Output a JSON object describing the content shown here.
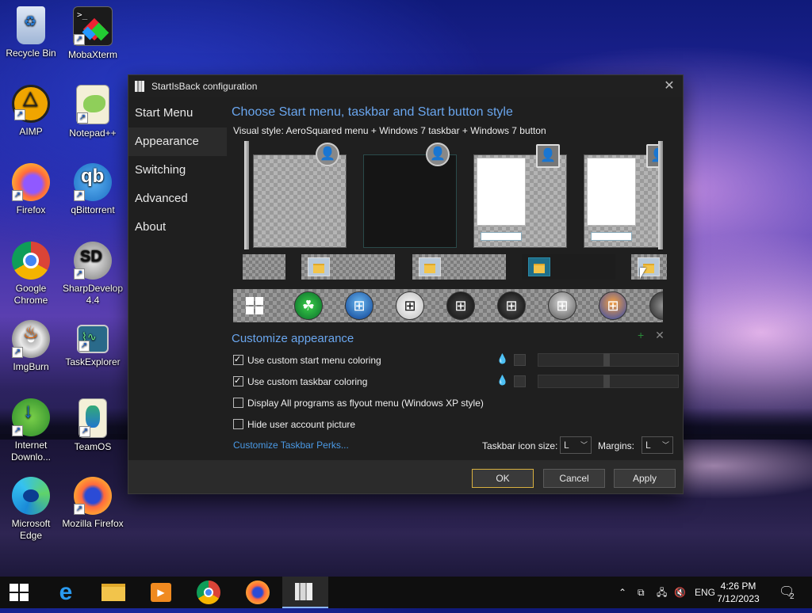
{
  "desktop": {
    "icons": [
      {
        "label": "Recycle Bin"
      },
      {
        "label": "MobaXterm"
      },
      {
        "label": "AIMP"
      },
      {
        "label": "Notepad++"
      },
      {
        "label": "Firefox"
      },
      {
        "label": "qBittorrent"
      },
      {
        "label": "Google Chrome"
      },
      {
        "label": "SharpDevelop 4.4"
      },
      {
        "label": "ImgBurn"
      },
      {
        "label": "TaskExplorer"
      },
      {
        "label": "Internet Downlo..."
      },
      {
        "label": "TeamOS"
      },
      {
        "label": "Microsoft Edge"
      },
      {
        "label": "Mozilla Firefox"
      }
    ]
  },
  "window": {
    "title": "StartIsBack configuration",
    "close_glyph": "✕",
    "nav": [
      "Start Menu",
      "Appearance",
      "Switching",
      "Advanced",
      "About"
    ],
    "selected_nav": "Appearance",
    "section1_title": "Choose Start menu, taskbar and Start button style",
    "visual_style": "Visual style:  AeroSquared menu + Windows 7 taskbar + Windows 7 button",
    "section2_title": "Customize appearance",
    "checkboxes": [
      {
        "label": "Use custom start menu coloring",
        "checked": true
      },
      {
        "label": "Use custom taskbar coloring",
        "checked": true
      },
      {
        "label": "Display All programs as flyout menu (Windows XP style)",
        "checked": false
      },
      {
        "label": "Hide user account picture",
        "checked": false
      }
    ],
    "link": "Customize Taskbar Perks...",
    "taskbar_icon_size_label": "Taskbar icon size:",
    "taskbar_icon_size_value": "L",
    "margins_label": "Margins:",
    "margins_value": "L",
    "buttons": {
      "ok": "OK",
      "cancel": "Cancel",
      "apply": "Apply"
    }
  },
  "taskbar": {
    "apps": [
      "start",
      "internet-explorer",
      "file-explorer",
      "media-player",
      "chrome",
      "firefox",
      "startisback"
    ],
    "language": "ENG",
    "time": "4:26 PM",
    "date": "7/12/2023",
    "notifications_count": "2"
  }
}
